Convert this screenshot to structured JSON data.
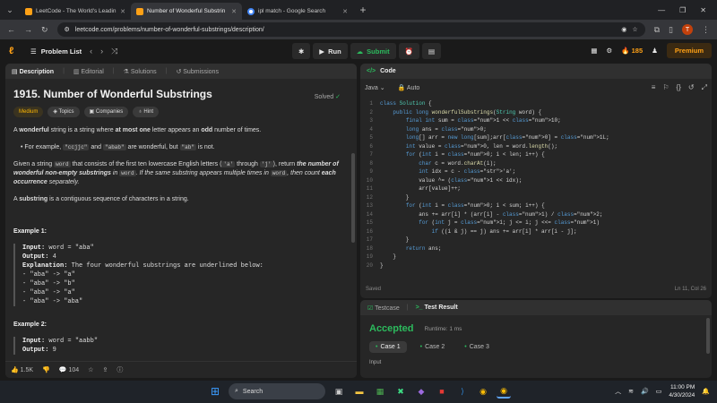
{
  "browser": {
    "tabs": [
      {
        "title": "LeetCode - The World's Leadin",
        "favicon_color": "#ffa116",
        "active": false
      },
      {
        "title": "Number of Wonderful Substrin",
        "favicon_color": "#ffa116",
        "active": true
      },
      {
        "title": "ipl match - Google Search",
        "favicon_color": "#4285f4",
        "active": false
      }
    ],
    "url": "leetcode.com/problems/number-of-wonderful-substrings/description/",
    "profile_initial": "T"
  },
  "topbar": {
    "problem_list": "Problem List",
    "run": "Run",
    "submit": "Submit",
    "streak": "185",
    "premium": "Premium"
  },
  "desc_tabs": [
    "Description",
    "Editorial",
    "Solutions",
    "Submissions"
  ],
  "problem": {
    "title": "1915. Number of Wonderful Substrings",
    "solved": "Solved",
    "difficulty": "Medium",
    "tags": [
      "Topics",
      "Companies",
      "Hint"
    ],
    "para1_a": "A ",
    "para1_b": "wonderful",
    "para1_c": " string is a string where ",
    "para1_d": "at most one",
    "para1_e": " letter appears an ",
    "para1_f": "odd",
    "para1_g": " number of times.",
    "bullet_a": "For example, ",
    "bullet_c1": "\"ccjjc\"",
    "bullet_b": " and ",
    "bullet_c2": "\"abab\"",
    "bullet_d": " are wonderful, but ",
    "bullet_c3": "\"ab\"",
    "bullet_e": " is not.",
    "para2_a": "Given a string ",
    "para2_c1": "word",
    "para2_b": " that consists of the first ten lowercase English letters (",
    "para2_c2": "'a'",
    "para2_through": " through ",
    "para2_c3": "'j'",
    "para2_d": "), return ",
    "para2_bi": "the number of wonderful non-empty substrings",
    "para2_in": " in ",
    "para2_c4": "word",
    "para2_i": ". If the same substring appears multiple times in ",
    "para2_c5": "word",
    "para2_j": ", then count ",
    "para2_bi2": "each occurrence",
    "para2_k": " separately.",
    "para3_a": "A ",
    "para3_b": "substring",
    "para3_c": " is a contiguous sequence of characters in a string.",
    "example1_title": "Example 1:",
    "example1_lines": [
      {
        "k": "Input:",
        "v": " word = \"aba\""
      },
      {
        "k": "Output:",
        "v": " 4"
      },
      {
        "k": "Explanation:",
        "v": " The four wonderful substrings are underlined below:"
      },
      {
        "k": "",
        "v": "- \"aba\" -> \"a\""
      },
      {
        "k": "",
        "v": "- \"aba\" -> \"b\""
      },
      {
        "k": "",
        "v": "- \"aba\" -> \"a\""
      },
      {
        "k": "",
        "v": "- \"aba\" -> \"aba\""
      }
    ],
    "example2_title": "Example 2:",
    "example2_lines": [
      {
        "k": "Input:",
        "v": " word = \"aabb\""
      },
      {
        "k": "Output:",
        "v": " 9"
      }
    ],
    "likes": "1.5K",
    "comments": "104"
  },
  "code": {
    "header": "Code",
    "language": "Java",
    "mode": "Auto",
    "lines": [
      "class Solution {",
      "    public long wonderfulSubstrings(String word) {",
      "        final int sum = 1 << 10;",
      "        long ans = 0;",
      "        long[] arr = new long[sum];arr[0] = 1L;",
      "        int value = 0, len = word.length();",
      "        for (int i = 0; i < len; i++) {",
      "            char c = word.charAt(i);",
      "            int idx = c - 'a';",
      "            value ^= (1 << idx);",
      "            arr[value]++;",
      "        }",
      "        for (int i = 0; i < sum; i++) {",
      "            ans += arr[i] * (arr[i] - 1) / 2;",
      "            for (int j = 1; j <= i; j <<= 1)",
      "                if ((i & j) == j) ans += arr[i] * arr[i - j];",
      "        }",
      "        return ans;",
      "    }",
      "}"
    ],
    "status": "Saved",
    "cursor": "Ln 11, Col 26"
  },
  "testpanel": {
    "tabs": [
      "Testcase",
      "Test Result"
    ],
    "result": "Accepted",
    "runtime": "Runtime: 1 ms",
    "cases": [
      "Case 1",
      "Case 2",
      "Case 3"
    ],
    "input_label": "Input"
  },
  "taskbar": {
    "search": "Search",
    "time": "11:00 PM",
    "date": "4/30/2024"
  },
  "colors": {
    "accent": "#ffa116",
    "accepted": "#2cbb5d",
    "medium": "#ffb800"
  }
}
